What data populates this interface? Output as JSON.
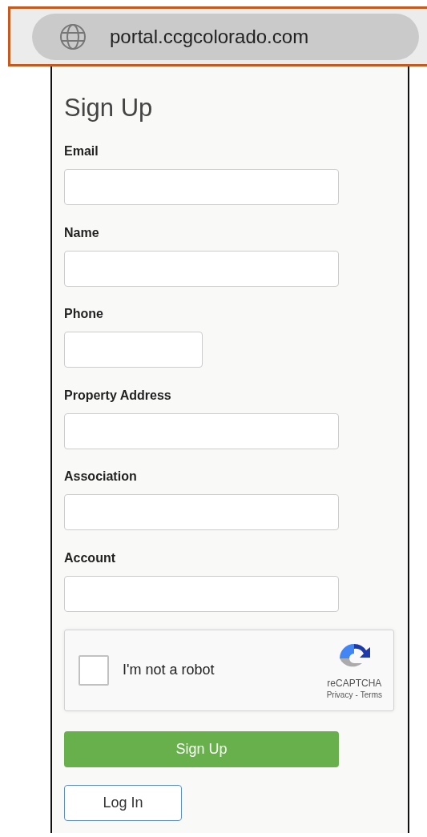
{
  "browser": {
    "url": "portal.ccgcolorado.com"
  },
  "form": {
    "title": "Sign Up",
    "fields": [
      {
        "label": "Email",
        "kind": "wide"
      },
      {
        "label": "Name",
        "kind": "wide"
      },
      {
        "label": "Phone",
        "kind": "narrow"
      },
      {
        "label": "Property Address",
        "kind": "wide"
      },
      {
        "label": "Association",
        "kind": "wide"
      },
      {
        "label": "Account",
        "kind": "wide"
      }
    ],
    "captcha": {
      "label": "I'm not a robot",
      "checked": false,
      "brand": "reCAPTCHA",
      "privacy": "Privacy",
      "separator": "-",
      "terms": "Terms"
    },
    "buttons": [
      {
        "label": "Sign Up",
        "kind": "primary"
      },
      {
        "label": "Log In",
        "kind": "secondary"
      }
    ]
  }
}
